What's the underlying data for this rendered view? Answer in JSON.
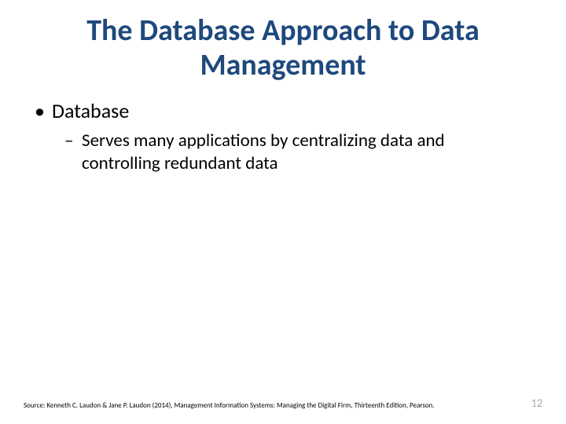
{
  "title": "The Database Approach to Data Management",
  "bullets": {
    "level1": "Database",
    "level2": "Serves many applications by centralizing data and controlling redundant data"
  },
  "footer": {
    "source": "Source: Kenneth C. Laudon & Jane P. Laudon (2014), Management Information Systems: Managing the Digital Firm, Thirteenth Edition, Pearson.",
    "pageNumber": "12"
  }
}
